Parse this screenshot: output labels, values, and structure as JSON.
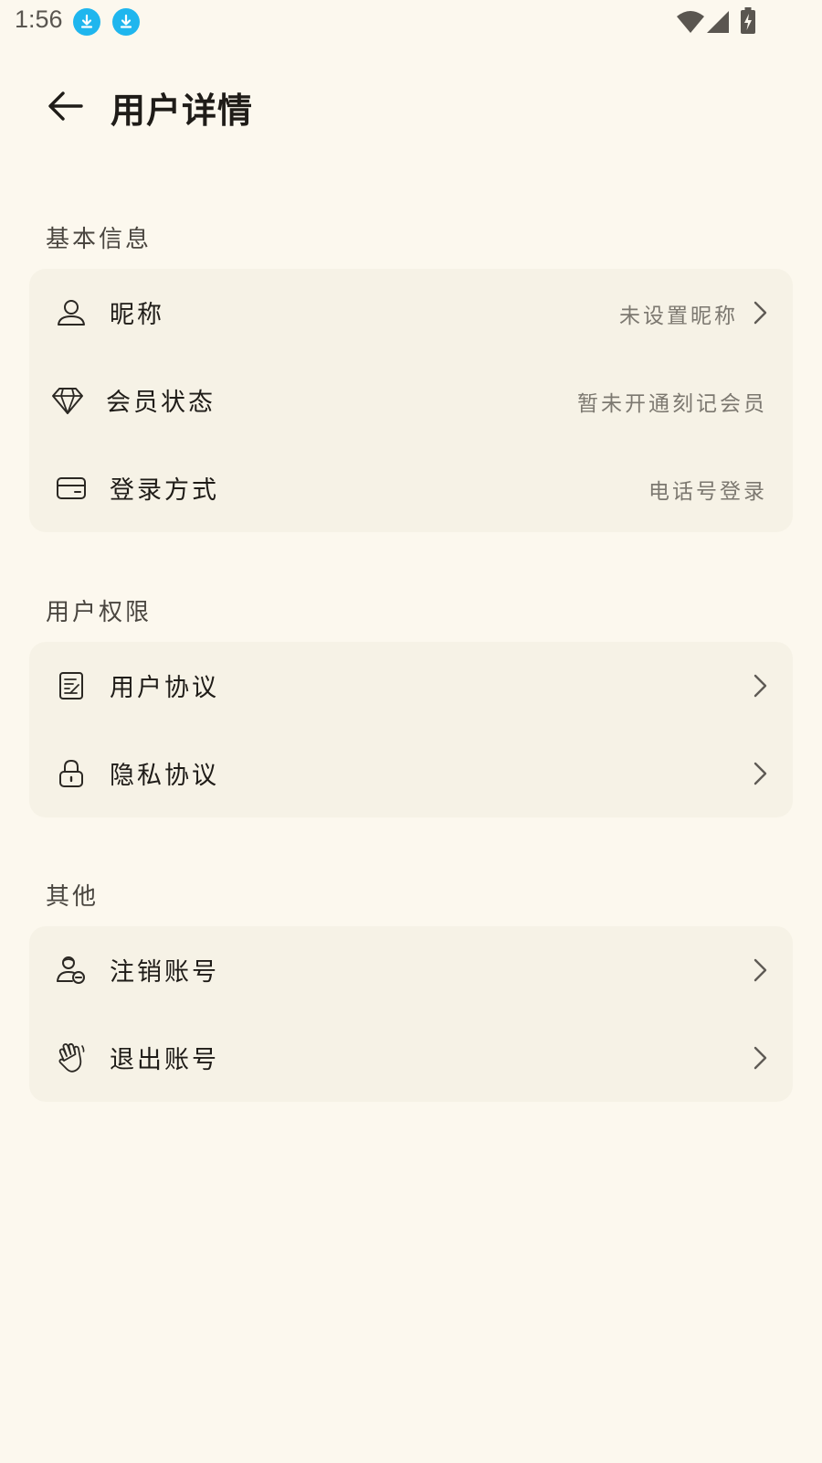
{
  "status_bar": {
    "time": "1:56",
    "icons": [
      "download-icon",
      "download-icon",
      "wifi-icon",
      "signal-icon",
      "battery-charging-icon"
    ]
  },
  "header": {
    "back_icon": "arrow-left-icon",
    "title": "用户详情"
  },
  "sections": {
    "basic": {
      "title": "基本信息",
      "nickname": {
        "icon": "person-icon",
        "label": "昵称",
        "value": "未设置昵称",
        "chevron": true
      },
      "membership": {
        "icon": "diamond-icon",
        "label": "会员状态",
        "value": "暂未开通刻记会员",
        "chevron": false
      },
      "login": {
        "icon": "card-icon",
        "label": "登录方式",
        "value": "电话号登录",
        "chevron": false
      }
    },
    "permissions": {
      "title": "用户权限",
      "agreement": {
        "icon": "document-icon",
        "label": "用户协议",
        "chevron": true
      },
      "privacy": {
        "icon": "lock-icon",
        "label": "隐私协议",
        "chevron": true
      }
    },
    "other": {
      "title": "其他",
      "delete_account": {
        "icon": "user-remove-icon",
        "label": "注销账号",
        "chevron": true
      },
      "logout": {
        "icon": "wave-hand-icon",
        "label": "退出账号",
        "chevron": true
      }
    }
  },
  "colors": {
    "background": "#fcf8ee",
    "card": "#f6f2e6",
    "text_primary": "#1f1c18",
    "text_secondary": "#7c7870",
    "download_badge": "#1fb6ee"
  }
}
